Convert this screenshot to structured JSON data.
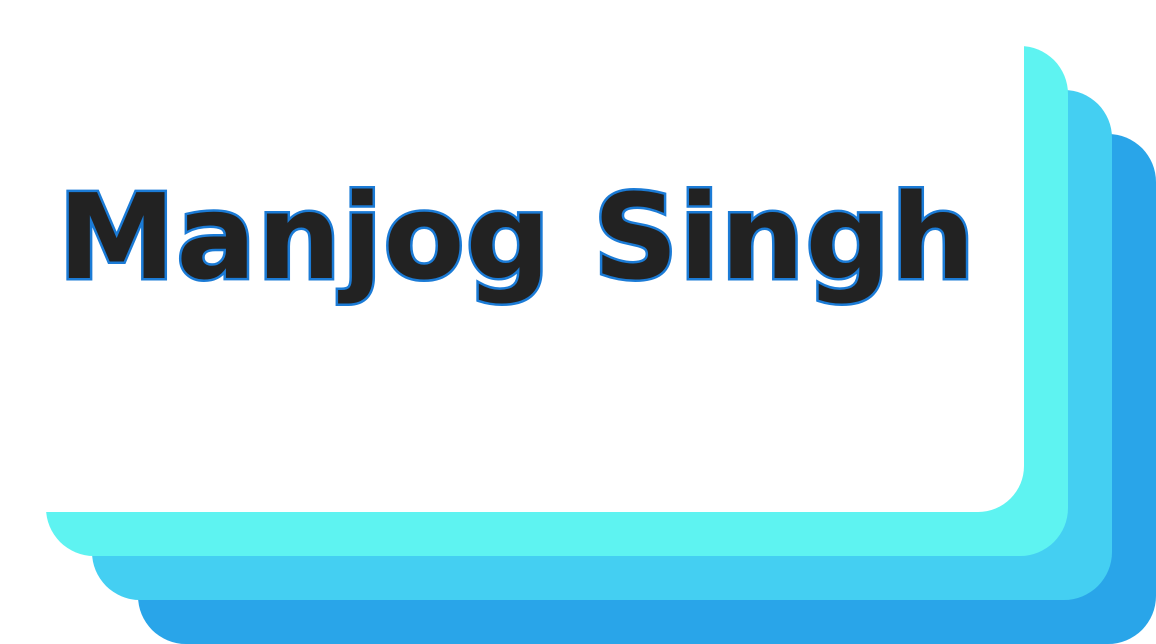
{
  "title": "Manjog Singh",
  "colors": {
    "card": "#ffffff",
    "front": "#5ef3f1",
    "middle": "#44cff2",
    "back": "#29a5e9",
    "title_fill": "#222222",
    "title_outline": "#1b7bd6"
  }
}
